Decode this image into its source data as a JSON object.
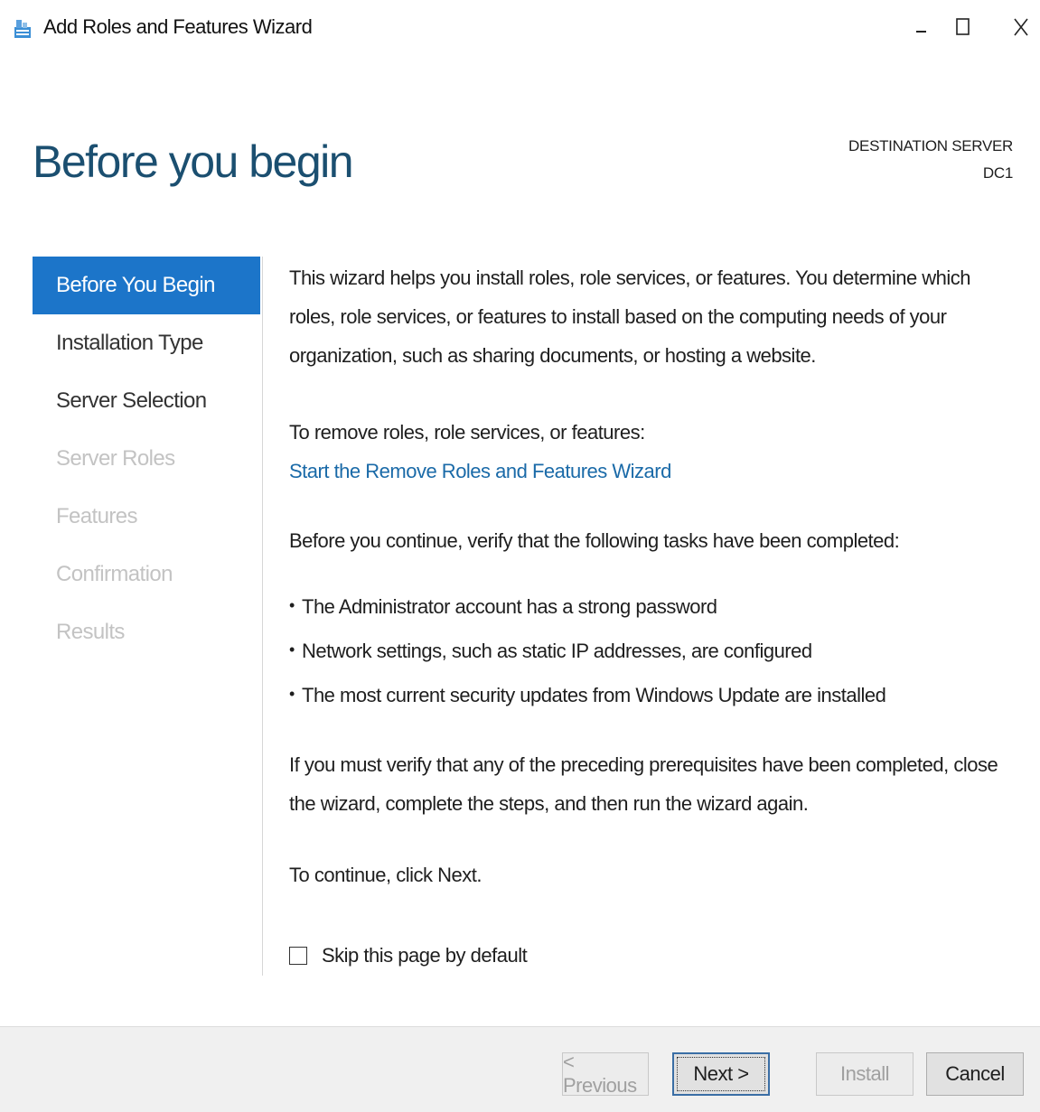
{
  "window": {
    "title": "Add Roles and Features Wizard",
    "controls": {
      "minimize": "–",
      "maximize": "☐",
      "close": "X"
    },
    "icon": "server-manager-icon"
  },
  "header": {
    "page_title": "Before you begin",
    "destination_label": "DESTINATION SERVER",
    "destination_value": "DC1"
  },
  "nav": {
    "items": [
      {
        "label": "Before You Begin",
        "state": "active"
      },
      {
        "label": "Installation Type",
        "state": "enabled"
      },
      {
        "label": "Server Selection",
        "state": "enabled"
      },
      {
        "label": "Server Roles",
        "state": "disabled"
      },
      {
        "label": "Features",
        "state": "disabled"
      },
      {
        "label": "Confirmation",
        "state": "disabled"
      },
      {
        "label": "Results",
        "state": "disabled"
      }
    ]
  },
  "content": {
    "intro": "This wizard helps you install roles, role services, or features. You determine which roles, role services, or features to install based on the computing needs of your organization, such as sharing documents, or hosting a website.",
    "remove_label": "To remove roles, role services, or features:",
    "remove_link": "Start the Remove Roles and Features Wizard",
    "verify_intro": "Before you continue, verify that the following tasks have been completed:",
    "bullets": [
      "The Administrator account has a strong password",
      "Network settings, such as static IP addresses, are configured",
      "The most current security updates from Windows Update are installed"
    ],
    "prereq_note": "If you must verify that any of the preceding prerequisites have been completed, close the wizard, complete the steps, and then run the wizard again.",
    "continue_note": "To continue, click Next.",
    "skip_checkbox": {
      "label": "Skip this page by default",
      "checked": false
    }
  },
  "footer": {
    "previous": "< Previous",
    "next": "Next >",
    "install": "Install",
    "cancel": "Cancel"
  },
  "colors": {
    "accent": "#1c75c9",
    "title": "#1b4f70",
    "link": "#1a6aa8",
    "disabled_text": "#c3c3c3"
  }
}
